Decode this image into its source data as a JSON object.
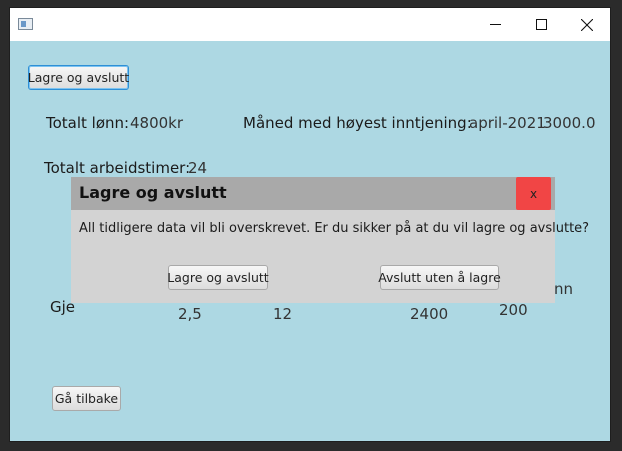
{
  "window": {
    "app_icon": "java-app-icon"
  },
  "main": {
    "save_button": "Lagre og avslutt",
    "total_pay_label": "Totalt lønn:",
    "total_pay_value": "4800kr",
    "top_month_label": "Måned med høyest inntjening:",
    "top_month_value": "april-2021",
    "top_month_amount": "3000.0",
    "total_hours_label": "Totalt arbeidstimer:",
    "total_hours_value": "24",
    "avg_label_partial": "Gje",
    "col_header_partial": "nn",
    "row_values": [
      "2,5",
      "12",
      "2400",
      "200"
    ],
    "back_button": "Gå tilbake"
  },
  "dialog": {
    "title": "Lagre og avslutt",
    "close_label": "x",
    "message": "All tidligere data vil bli overskrevet. Er du sikker på at du vil lagre og avslutte?",
    "confirm_button": "Lagre og avslutt",
    "exit_button": "Avslutt uten å lagre"
  }
}
